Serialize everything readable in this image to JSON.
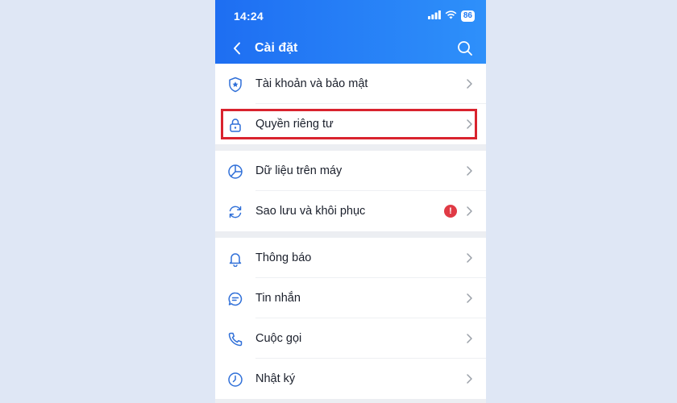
{
  "status_bar": {
    "time": "14:24",
    "battery": "86"
  },
  "header": {
    "title": "Cài đặt",
    "back_icon": "chevron-left-icon",
    "search_icon": "search-icon"
  },
  "groups": [
    {
      "items": [
        {
          "label": "Tài khoản và bảo mật",
          "icon": "shield-star-icon"
        },
        {
          "label": "Quyền riêng tư",
          "icon": "lock-icon",
          "highlighted": true
        }
      ]
    },
    {
      "items": [
        {
          "label": "Dữ liệu trên máy",
          "icon": "pie-chart-icon"
        },
        {
          "label": "Sao lưu và khôi phục",
          "icon": "sync-icon",
          "alert": "!"
        }
      ]
    },
    {
      "items": [
        {
          "label": "Thông báo",
          "icon": "bell-icon"
        },
        {
          "label": "Tin nhắn",
          "icon": "chat-bubble-icon"
        },
        {
          "label": "Cuộc gọi",
          "icon": "phone-icon"
        },
        {
          "label": "Nhật ký",
          "icon": "clock-icon"
        }
      ]
    }
  ],
  "colors": {
    "header_start": "#1e6ef2",
    "header_end": "#2e90fa",
    "icon_blue": "#2f6fd8",
    "highlight_red": "#d9232e",
    "alert_red": "#e03a45"
  }
}
